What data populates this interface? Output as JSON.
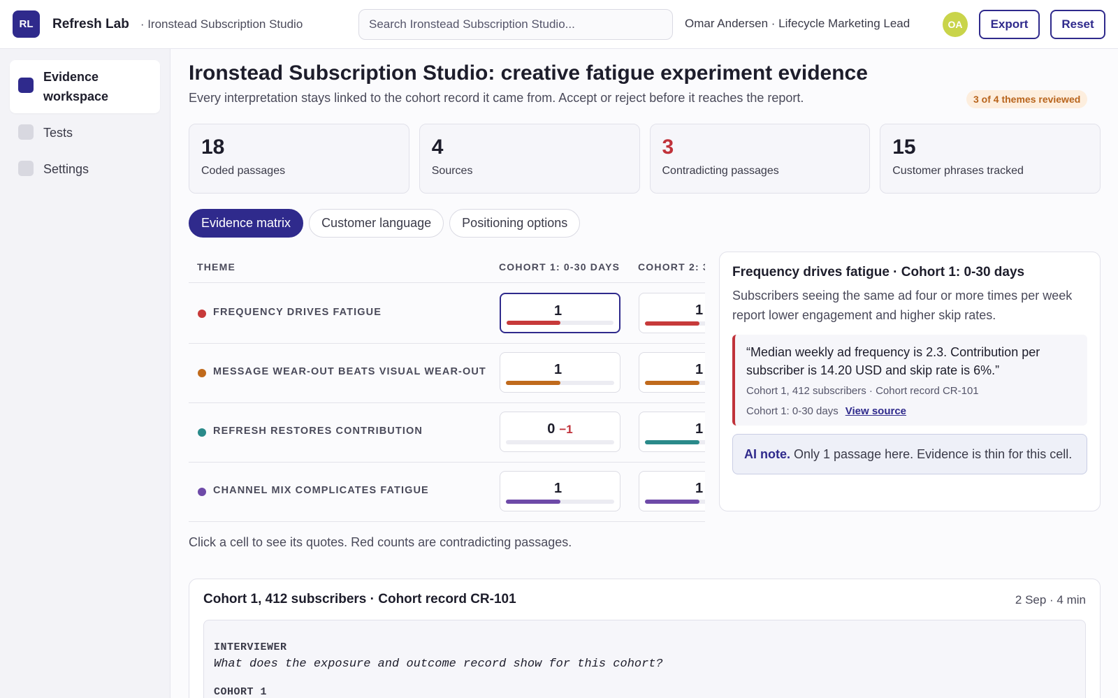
{
  "app": {
    "logo_initials": "RL",
    "name": "Refresh Lab",
    "workspace": "· Ironstead Subscription Studio"
  },
  "search": {
    "placeholder": "Search Ironstead Subscription Studio..."
  },
  "user": {
    "line": "Omar Andersen · Lifecycle Marketing Lead",
    "initials": "OA"
  },
  "actions": {
    "export_label": "Export",
    "reset_label": "Reset"
  },
  "sidebar": {
    "items": [
      {
        "label": "Evidence workspace",
        "active": true
      },
      {
        "label": "Tests",
        "active": false
      },
      {
        "label": "Settings",
        "active": false
      }
    ]
  },
  "page": {
    "title": "Ironstead Subscription Studio: creative fatigue experiment evidence",
    "subtitle": "Every interpretation stays linked to the cohort record it came from. Accept or reject before it reaches the report.",
    "review_badge": "3 of 4 themes reviewed"
  },
  "stats": [
    {
      "value": "18",
      "label": "Coded passages",
      "highlight": false
    },
    {
      "value": "4",
      "label": "Sources",
      "highlight": false
    },
    {
      "value": "3",
      "label": "Contradicting passages",
      "highlight": true
    },
    {
      "value": "15",
      "label": "Customer phrases tracked",
      "highlight": false
    }
  ],
  "tabs": [
    {
      "label": "Evidence matrix",
      "active": true
    },
    {
      "label": "Customer language",
      "active": false
    },
    {
      "label": "Positioning options",
      "active": false
    }
  ],
  "matrix": {
    "headers": {
      "theme": "THEME",
      "cohort1": "COHORT 1: 0-30 DAYS",
      "cohort2": "COHORT 2: 3"
    },
    "rows": [
      {
        "theme": "FREQUENCY DRIVES FATIGUE",
        "color": "#c73a3a",
        "c1": {
          "count": "1",
          "contra": "",
          "fill": 0.5
        },
        "c2": {
          "count": "1",
          "fill": 0.5
        }
      },
      {
        "theme": "MESSAGE WEAR-OUT BEATS VISUAL WEAR-OUT",
        "color": "#c06a1c",
        "c1": {
          "count": "1",
          "contra": "",
          "fill": 0.5
        },
        "c2": {
          "count": "1",
          "fill": 0.5
        }
      },
      {
        "theme": "REFRESH RESTORES CONTRIBUTION",
        "color": "#2a8a8a",
        "c1": {
          "count": "0",
          "contra": "−1",
          "fill": 0
        },
        "c2": {
          "count": "1",
          "fill": 0.5
        }
      },
      {
        "theme": "CHANNEL MIX COMPLICATES FATIGUE",
        "color": "#6e4aa8",
        "c1": {
          "count": "1",
          "contra": "",
          "fill": 0.5
        },
        "c2": {
          "count": "1",
          "fill": 0.5
        }
      }
    ],
    "help": "Click a cell to see its quotes. Red counts are contradicting passages."
  },
  "detail": {
    "title": "Frequency drives fatigue · Cohort 1: 0-30 days",
    "description": "Subscribers seeing the same ad four or more times per week report lower engagement and higher skip rates.",
    "quote": "“Median weekly ad frequency is 2.3. Contribution per subscriber is 14.20 USD and skip rate is 6%.”",
    "quote_meta": "Cohort 1, 412 subscribers · Cohort record CR-101",
    "quote_cohort": "Cohort 1: 0-30 days",
    "view_source": "View source",
    "ai_note_label": "AI note.",
    "ai_note_text": " Only 1 passage here. Evidence is thin for this cell."
  },
  "transcript": {
    "title": "Cohort 1, 412 subscribers · Cohort record CR-101",
    "meta": "2 Sep · 4 min",
    "speaker1": "INTERVIEWER",
    "utterance1": "What does the exposure and outcome record show for this cohort?",
    "speaker2": "COHORT 1"
  }
}
